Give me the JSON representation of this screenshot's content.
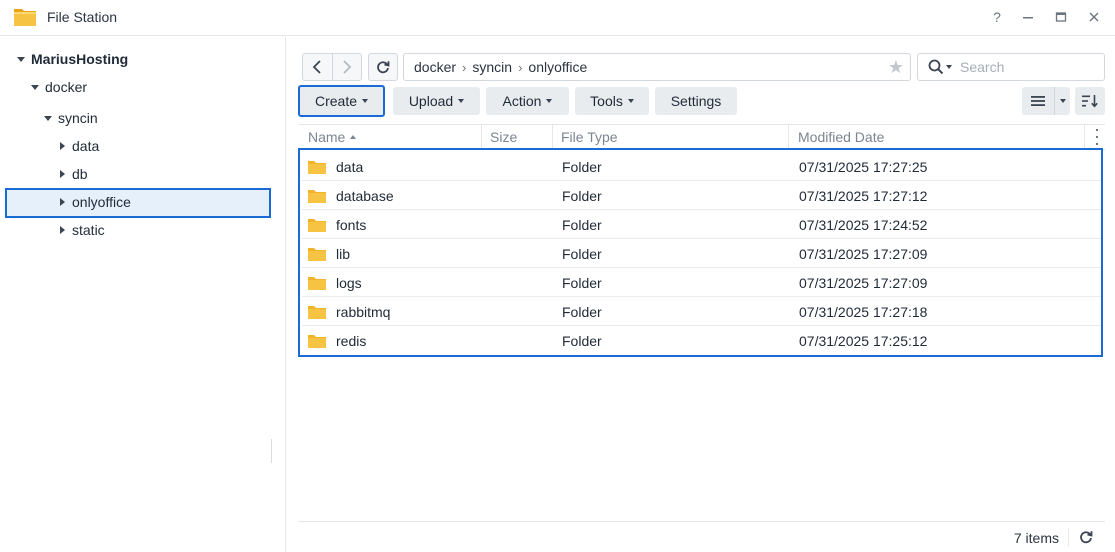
{
  "window": {
    "title": "File Station",
    "help_label": "?",
    "minimize_label": "—",
    "maximize_label": "□",
    "close_label": "✕"
  },
  "sidebar": {
    "root": "MariusHosting",
    "docker": "docker",
    "syncin": "syncin",
    "items": [
      "data",
      "db",
      "onlyoffice",
      "static"
    ],
    "selected": "onlyoffice"
  },
  "path": {
    "segments": [
      "docker",
      "syncin",
      "onlyoffice"
    ],
    "separator": "›"
  },
  "search": {
    "placeholder": "Search"
  },
  "toolbar": {
    "create": "Create",
    "upload": "Upload",
    "action": "Action",
    "tools": "Tools",
    "settings": "Settings"
  },
  "table": {
    "columns": [
      "Name",
      "Size",
      "File Type",
      "Modified Date"
    ],
    "rows": [
      {
        "name": "data",
        "size": "",
        "type": "Folder",
        "modified": "07/31/2025 17:27:25"
      },
      {
        "name": "database",
        "size": "",
        "type": "Folder",
        "modified": "07/31/2025 17:27:12"
      },
      {
        "name": "fonts",
        "size": "",
        "type": "Folder",
        "modified": "07/31/2025 17:24:52"
      },
      {
        "name": "lib",
        "size": "",
        "type": "Folder",
        "modified": "07/31/2025 17:27:09"
      },
      {
        "name": "logs",
        "size": "",
        "type": "Folder",
        "modified": "07/31/2025 17:27:09"
      },
      {
        "name": "rabbitmq",
        "size": "",
        "type": "Folder",
        "modified": "07/31/2025 17:27:18"
      },
      {
        "name": "redis",
        "size": "",
        "type": "Folder",
        "modified": "07/31/2025 17:25:12"
      }
    ]
  },
  "status": {
    "item_count": "7 items"
  },
  "colors": {
    "accent": "#1a6bd6",
    "folder": "#f7c342",
    "selected_bg": "#e6f0fb"
  }
}
